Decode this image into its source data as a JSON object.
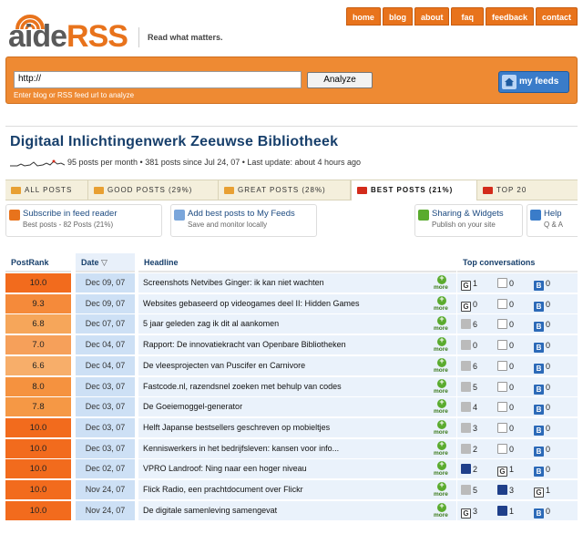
{
  "brand": {
    "aide": "aide",
    "rss": "RSS",
    "tagline": "Read what matters."
  },
  "nav": [
    "home",
    "blog",
    "about",
    "faq",
    "feedback",
    "contact"
  ],
  "analyze": {
    "url_value": "http://",
    "button_label": "Analyze",
    "hint": "Enter blog or RSS feed url to analyze",
    "myfeeds_label": "my feeds"
  },
  "feed": {
    "title": "Digitaal Inlichtingenwerk Zeeuwse Bibliotheek",
    "stats": "95 posts per month  •  381 posts since Jul 24, 07  •  Last update: about 4 hours ago"
  },
  "tabs": [
    {
      "label": "ALL POSTS"
    },
    {
      "label": "GOOD POSTS (29%)"
    },
    {
      "label": "GREAT POSTS (28%)"
    },
    {
      "label": "BEST POSTS (21%)"
    },
    {
      "label": "TOP 20"
    }
  ],
  "actions": [
    {
      "title": "Subscribe in feed reader",
      "sub": "Best posts - 82 Posts (21%)"
    },
    {
      "title": "Add best posts to My Feeds",
      "sub": "Save and monitor locally"
    },
    {
      "title": "Sharing & Widgets",
      "sub": "Publish on your site"
    },
    {
      "title": "Help",
      "sub": "Q & A"
    }
  ],
  "table": {
    "headers": {
      "rank": "PostRank",
      "date": "Date",
      "headline": "Headline",
      "conversations": "Top conversations"
    },
    "more_label": "more",
    "rows": [
      {
        "rank": "10.0",
        "date": "Dec 09, 07",
        "headline": "Screenshots Netvibes Ginger: ik kan niet wachten",
        "c1": "1",
        "c2": "0",
        "c3": "0",
        "icons": [
          "g",
          "s",
          "b"
        ],
        "color": "#f26b1d"
      },
      {
        "rank": "9.3",
        "date": "Dec 09, 07",
        "headline": "Websites gebaseerd op videogames deel II: Hidden Games",
        "c1": "0",
        "c2": "0",
        "c3": "0",
        "icons": [
          "g",
          "s",
          "b"
        ],
        "color": "#f58a3a"
      },
      {
        "rank": "6.8",
        "date": "Dec 07, 07",
        "headline": "5 jaar geleden zag ik dit al aankomen",
        "c1": "6",
        "c2": "0",
        "c3": "0",
        "icons": [
          "c",
          "s",
          "b"
        ],
        "color": "#f6a65a"
      },
      {
        "rank": "7.0",
        "date": "Dec 04, 07",
        "headline": "Rapport: De innovatiekracht van Openbare Bibliotheken",
        "c1": "0",
        "c2": "0",
        "c3": "0",
        "icons": [
          "c",
          "s",
          "b"
        ],
        "color": "#f6a05a"
      },
      {
        "rank": "6.6",
        "date": "Dec 04, 07",
        "headline": "De vleesprojecten van Puscifer en Carnivore",
        "c1": "6",
        "c2": "0",
        "c3": "0",
        "icons": [
          "c",
          "s",
          "b"
        ],
        "color": "#f7ae6a"
      },
      {
        "rank": "8.0",
        "date": "Dec 03, 07",
        "headline": "Fastcode.nl, razendsnel zoeken met behulp van codes",
        "c1": "5",
        "c2": "0",
        "c3": "0",
        "icons": [
          "c",
          "s",
          "b"
        ],
        "color": "#f5923f"
      },
      {
        "rank": "7.8",
        "date": "Dec 03, 07",
        "headline": "De Goeiemoggel-generator",
        "c1": "4",
        "c2": "0",
        "c3": "0",
        "icons": [
          "c",
          "s",
          "b"
        ],
        "color": "#f59845"
      },
      {
        "rank": "10.0",
        "date": "Dec 03, 07",
        "headline": "Helft Japanse bestsellers geschreven op mobieltjes",
        "c1": "3",
        "c2": "0",
        "c3": "0",
        "icons": [
          "c",
          "s",
          "b"
        ],
        "color": "#f26b1d"
      },
      {
        "rank": "10.0",
        "date": "Dec 03, 07",
        "headline": "Kenniswerkers in het bedrijfsleven: kansen voor info...",
        "c1": "2",
        "c2": "0",
        "c3": "0",
        "icons": [
          "c",
          "s",
          "b"
        ],
        "color": "#f26b1d"
      },
      {
        "rank": "10.0",
        "date": "Dec 02, 07",
        "headline": "VPRO Landroof: Ning naar een hoger niveau",
        "c1": "2",
        "c2": "1",
        "c3": "0",
        "icons": [
          "d",
          "g",
          "b"
        ],
        "color": "#f26b1d"
      },
      {
        "rank": "10.0",
        "date": "Nov 24, 07",
        "headline": "Flick Radio, een prachtdocument over Flickr",
        "c1": "5",
        "c2": "3",
        "c3": "1",
        "icons": [
          "c",
          "d",
          "g"
        ],
        "color": "#f26b1d"
      },
      {
        "rank": "10.0",
        "date": "Nov 24, 07",
        "headline": "De digitale samenleving samengevat",
        "c1": "3",
        "c2": "1",
        "c3": "0",
        "icons": [
          "g",
          "d",
          "b"
        ],
        "color": "#f26b1d"
      }
    ]
  }
}
